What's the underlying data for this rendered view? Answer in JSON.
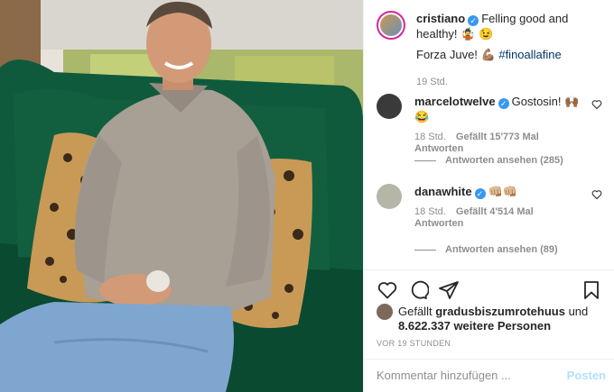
{
  "caption": {
    "username": "cristiano",
    "text_line1": "Felling good and healthy!",
    "text_line1_emoji": "🤹 😉",
    "text_line2": "Forza Juve! 💪🏽",
    "hashtag": "#finoallafine",
    "time": "19 Std."
  },
  "comments": [
    {
      "username": "marcelotwelve",
      "text": "Gostosin! 🙌🏾😂",
      "time": "18 Std.",
      "likes": "Gefällt 15'773 Mal",
      "reply": "Antworten",
      "view_replies": "Antworten ansehen (285)"
    },
    {
      "username": "danawhite",
      "text": "👊🏼👊🏼",
      "time": "18 Std.",
      "likes": "Gefällt 4'514 Mal",
      "reply": "Antworten",
      "view_replies": "Antworten ansehen (89)"
    }
  ],
  "likes": {
    "prefix": "Gefällt",
    "user": "gradusbiszumrotehuus",
    "joiner": "und",
    "others": "8.622.337 weitere Personen"
  },
  "timestamp": "VOR 19 STUNDEN",
  "comment_input": {
    "placeholder": "Kommentar hinzufügen ...",
    "post_label": "Posten"
  },
  "icons": {
    "verified": "verified-badge-icon",
    "like": "heart-icon",
    "comment": "comment-icon",
    "share": "paper-plane-icon",
    "save": "bookmark-icon"
  },
  "colors": {
    "verified": "#3897f0",
    "hashtag": "#00376b",
    "muted": "#8e8e8e",
    "post_button": "#b2dffc"
  }
}
